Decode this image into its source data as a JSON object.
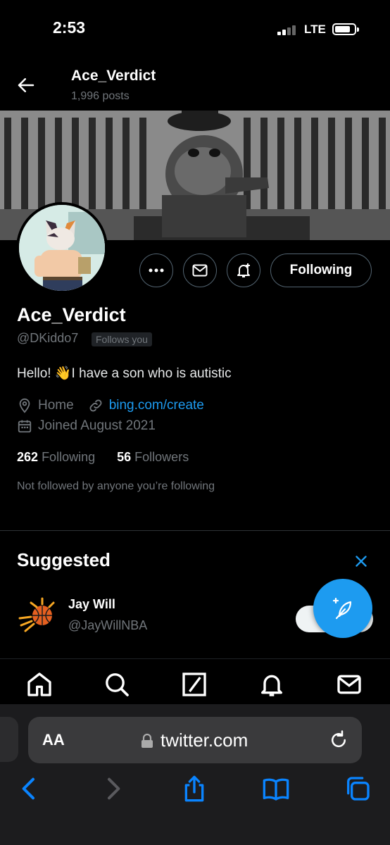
{
  "status_bar": {
    "time": "2:53",
    "network": "LTE"
  },
  "header": {
    "name": "Ace_Verdict",
    "posts": "1,996 posts"
  },
  "profile": {
    "display_name": "Ace_Verdict",
    "handle": "@DKiddo7",
    "follows_you": "Follows you",
    "bio": "Hello! 👋I have a son who is autistic",
    "location": "Home",
    "website": "bing.com/create",
    "joined": "Joined August 2021",
    "following_count": "262",
    "following_label": "Following",
    "followers_count": "56",
    "followers_label": "Followers",
    "not_followed": "Not followed by anyone you’re following",
    "following_button": "Following"
  },
  "suggested": {
    "title": "Suggested",
    "items": [
      {
        "name": "Jay Will",
        "handle": "@JayWillNBA"
      }
    ]
  },
  "safari": {
    "aa_label": "AA",
    "url": "twitter.com"
  },
  "colors": {
    "accent": "#1d9bf0",
    "background": "#000000",
    "muted": "#71767b"
  }
}
